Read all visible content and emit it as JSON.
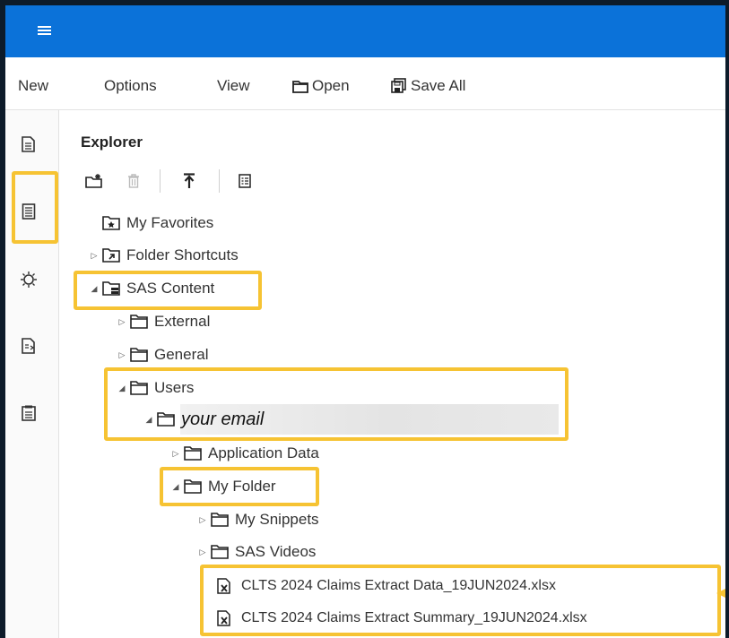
{
  "menubar": {
    "new": "New",
    "options": "Options",
    "view": "View",
    "open": "Open",
    "save_all": "Save All"
  },
  "explorer": {
    "title": "Explorer"
  },
  "tree": {
    "my_favorites": "My Favorites",
    "folder_shortcuts": "Folder Shortcuts",
    "sas_content": "SAS Content",
    "external": "External",
    "general": "General",
    "users": "Users",
    "user_email": "your email",
    "application_data": "Application Data",
    "my_folder": "My Folder",
    "my_snippets": "My Snippets",
    "sas_videos": "SAS Videos",
    "file_1": "CLTS 2024 Claims Extract Data_19JUN2024.xlsx",
    "file_2": "CLTS 2024 Claims Extract Summary_19JUN2024.xlsx"
  },
  "icons": {
    "menu": "hamburger-icon",
    "open": "folder-open-icon",
    "save_all": "save-all-icon",
    "rail": [
      "open-files-icon",
      "explorer-icon",
      "snippets-icon",
      "libraries-icon",
      "tasks-icon"
    ],
    "toolbar": [
      "new-folder-icon",
      "delete-icon",
      "upload-icon",
      "properties-icon"
    ],
    "excel_file": "excel-file-icon"
  },
  "colors": {
    "topbar": "#0b72d9",
    "highlight": "#f6c333",
    "background_frame": "#0d1b2a"
  }
}
